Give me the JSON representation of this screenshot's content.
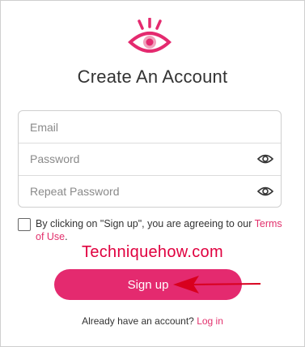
{
  "header": {
    "title": "Create An Account",
    "logo_icon": "eye-lashes-icon",
    "brand_color": "#e42a6f"
  },
  "form": {
    "email_placeholder": "Email",
    "password_placeholder": "Password",
    "repeat_password_placeholder": "Repeat Password",
    "show_password_icon": "eye-icon"
  },
  "consent": {
    "text": "By clicking on \"Sign up\", you are agreeing to our ",
    "terms_link": "Terms of Use",
    "suffix": ".",
    "checked": false
  },
  "watermark": {
    "text": "Techniquehow.com",
    "color": "#e0003f"
  },
  "actions": {
    "signup_label": "Sign up"
  },
  "footer": {
    "prompt": "Already have an account?",
    "login_link": "Log in"
  }
}
